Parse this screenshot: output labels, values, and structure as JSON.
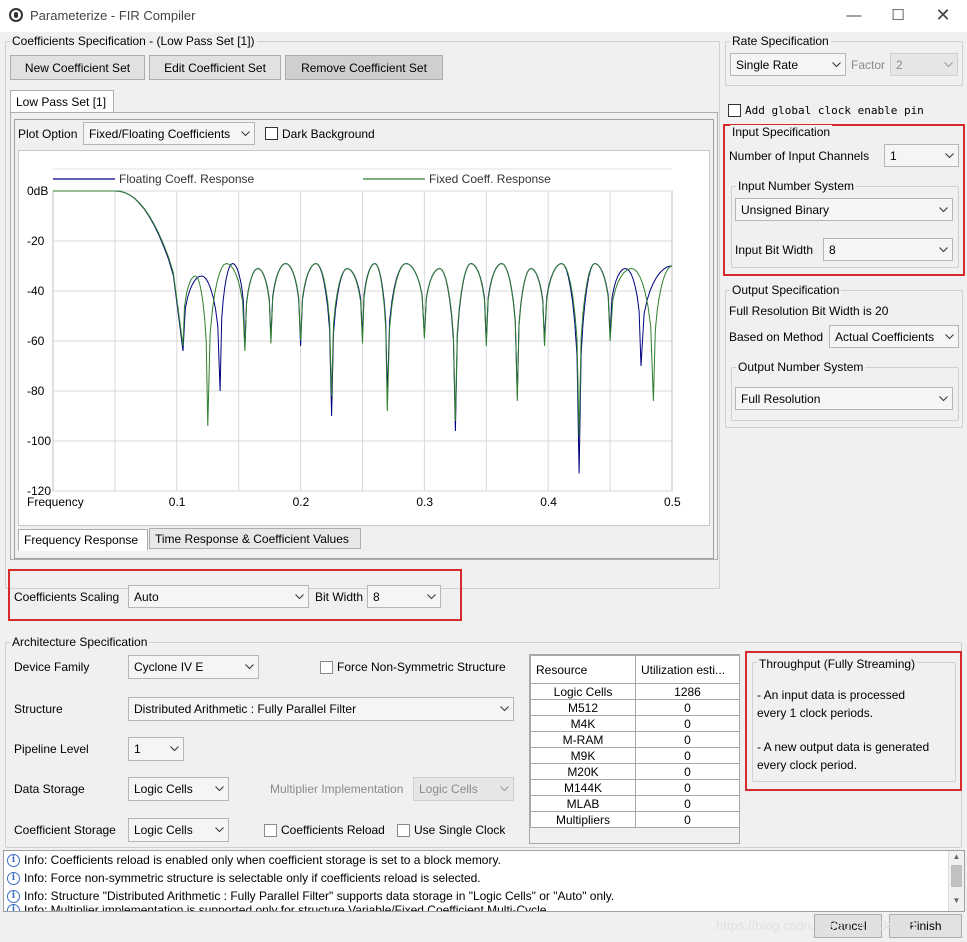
{
  "window": {
    "title": "Parameterize - FIR Compiler"
  },
  "coef_spec": {
    "title": "Coefficients Specification - (Low Pass Set [1])",
    "new_label": "New Coefficient Set",
    "edit_label": "Edit Coefficient Set",
    "remove_label": "Remove Coefficient Set",
    "tab_label": "Low Pass Set [1]",
    "plot_option_label": "Plot Option",
    "plot_option_value": "Fixed/Floating Coefficients",
    "dark_bg_label": "Dark Background",
    "bottom_tabs": [
      "Frequency Response",
      "Time Response & Coefficient Values"
    ]
  },
  "chart_data": {
    "type": "line",
    "title": "",
    "xlabel": "Frequency",
    "ylabel": "",
    "xlim": [
      0,
      0.5
    ],
    "ylim": [
      -120,
      0
    ],
    "x_ticks": [
      "0.1",
      "0.2",
      "0.3",
      "0.4",
      "0.5"
    ],
    "y_ticks": [
      "0dB",
      "-20",
      "-40",
      "-60",
      "-80",
      "-100",
      "-120"
    ],
    "grid": true,
    "legend_position": "top",
    "series": [
      {
        "name": "Floating Coeff. Response",
        "color": "#000080",
        "passband_edge": 0.05,
        "stopband_ripple_peak": -28,
        "nulls": [
          0.105,
          0.135,
          0.155,
          0.176,
          0.2,
          0.225,
          0.25,
          0.27,
          0.3,
          0.325,
          0.35,
          0.375,
          0.397,
          0.425,
          0.45,
          0.475
        ],
        "null_depths": [
          -64,
          -80,
          -63,
          -59,
          -62,
          -90,
          -58,
          -82,
          -58,
          -96,
          -60,
          -82,
          -60,
          -113,
          -58,
          -70
        ]
      },
      {
        "name": "Fixed Coeff. Response",
        "color": "#2f7f2f",
        "passband_edge": 0.05,
        "stopband_ripple_peak": -28,
        "nulls": [
          0.105,
          0.125,
          0.155,
          0.176,
          0.2,
          0.225,
          0.25,
          0.27,
          0.3,
          0.325,
          0.35,
          0.375,
          0.397,
          0.425,
          0.45,
          0.485
        ],
        "null_depths": [
          -62,
          -94,
          -64,
          -61,
          -60,
          -82,
          -61,
          -88,
          -59,
          -92,
          -62,
          -84,
          -62,
          -98,
          -60,
          -84
        ]
      }
    ]
  },
  "coef_scaling": {
    "label": "Coefficients Scaling",
    "value": "Auto",
    "bit_width_label": "Bit Width",
    "bit_width_value": "8"
  },
  "rate_spec": {
    "title": "Rate Specification",
    "value": "Single Rate",
    "factor_label": "Factor",
    "factor_value": "2",
    "global_clock_label": "Add global clock enable pin"
  },
  "input_spec": {
    "title": "Input Specification",
    "channels_label": "Number of Input Channels",
    "channels_value": "1",
    "number_system_title": "Input Number System",
    "number_system_value": "Unsigned Binary",
    "bit_width_label": "Input Bit Width",
    "bit_width_value": "8"
  },
  "output_spec": {
    "title": "Output Specification",
    "full_res_text": "Full Resolution Bit Width is 20",
    "based_on_label": "Based on Method",
    "based_on_value": "Actual Coefficients",
    "number_system_title": "Output Number System",
    "number_system_value": "Full Resolution"
  },
  "arch": {
    "title": "Architecture Specification",
    "device_family_label": "Device Family",
    "device_family_value": "Cyclone IV E",
    "force_nonsym_label": "Force Non-Symmetric Structure",
    "structure_label": "Structure",
    "structure_value": "Distributed Arithmetic : Fully Parallel Filter",
    "pipeline_label": "Pipeline Level",
    "pipeline_value": "1",
    "data_storage_label": "Data Storage",
    "data_storage_value": "Logic Cells",
    "mult_impl_label": "Multiplier Implementation",
    "mult_impl_value": "Logic Cells",
    "coef_storage_label": "Coefficient Storage",
    "coef_storage_value": "Logic Cells",
    "coef_reload_label": "Coefficients Reload",
    "single_clock_label": "Use Single Clock"
  },
  "resource_table": {
    "headers": [
      "Resource",
      "Utilization esti..."
    ],
    "rows": [
      [
        "Logic Cells",
        "1286"
      ],
      [
        "M512",
        "0"
      ],
      [
        "M4K",
        "0"
      ],
      [
        "M-RAM",
        "0"
      ],
      [
        "M9K",
        "0"
      ],
      [
        "M20K",
        "0"
      ],
      [
        "M144K",
        "0"
      ],
      [
        "MLAB",
        "0"
      ],
      [
        "Multipliers",
        "0"
      ]
    ]
  },
  "throughput": {
    "title": "Throughput (Fully Streaming)",
    "line1": "- An input data is processed",
    "line2": "every 1 clock periods.",
    "line3": "- A new output data is generated",
    "line4": "every clock period."
  },
  "info_messages": [
    "Info: Coefficients reload is enabled only when coefficient storage is set to a block memory.",
    "Info: Force non-symmetric structure is selectable only if coefficients reload is selected.",
    "Info: Structure \"Distributed Arithmetic : Fully Parallel Filter\" supports data storage in \"Logic Cells\" or \"Auto\" only.",
    "Info: Multiplier implementation is supported only for structure Variable/Fixed Coefficient Multi-Cycle"
  ],
  "footer": {
    "cancel_label": "Cancel",
    "finish_label": "Finish",
    "watermark": "https://blog.csdn.net/qq_41604036"
  }
}
